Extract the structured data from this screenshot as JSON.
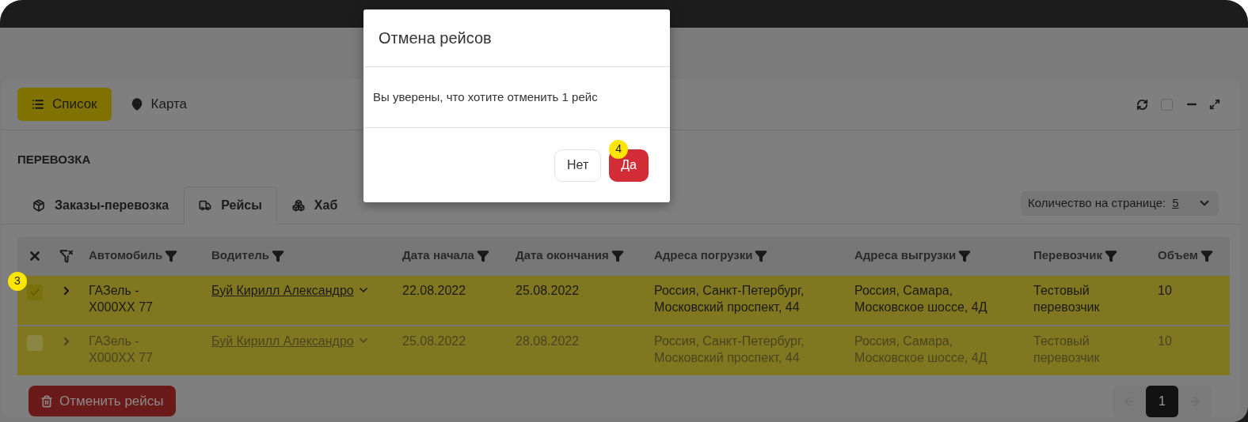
{
  "views": [
    {
      "label": "Список",
      "selected": true
    },
    {
      "label": "Карта",
      "selected": false
    }
  ],
  "window_controls": {
    "checkbox_checked": false
  },
  "section_title": "ПЕРЕВОЗКА",
  "tabs": [
    {
      "label": "Заказы-перевозка",
      "selected": false
    },
    {
      "label": "Рейсы",
      "selected": true
    },
    {
      "label": "Хаб",
      "selected": false
    }
  ],
  "page_size": {
    "label": "Количество на странице:",
    "value": "5"
  },
  "table": {
    "columns": [
      "Автомобиль",
      "Водитель",
      "Дата начала",
      "Дата окончания",
      "Адреса погрузки",
      "Адреса выгрузки",
      "Перевозчик",
      "Объем"
    ],
    "rows": [
      {
        "checked": true,
        "disabled": false,
        "marker": "3",
        "cells": [
          "ГАЗель - X000XX 77",
          "Буй Кирилл Александро",
          "22.08.2022",
          "25.08.2022",
          "Россия, Санкт-Петербург, Московский проспект, 44",
          "Россия, Самара, Московское шоссе, 4Д",
          "Тестовый перевозчик",
          "10"
        ]
      },
      {
        "checked": false,
        "disabled": true,
        "cells": [
          "ГАЗель - X000XX 77",
          "Буй Кирилл Александро",
          "25.08.2022",
          "28.08.2022",
          "Россия, Санкт-Петербург, Московский проспект, 44",
          "Россия, Самара, Московское шоссе, 4Д",
          "Тестовый перевозчик",
          "10"
        ]
      }
    ]
  },
  "cancel_button": "Отменить рейсы",
  "pagination": {
    "pages": [
      {
        "label": "1",
        "selected": true
      }
    ]
  },
  "dialog": {
    "title": "Отмена рейсов",
    "message": "Вы уверены, что хотите отменить 1 рейс",
    "buttons": [
      {
        "label": "Нет",
        "kind": "secondary"
      },
      {
        "label": "Да",
        "kind": "danger",
        "marker": "4"
      }
    ]
  }
}
